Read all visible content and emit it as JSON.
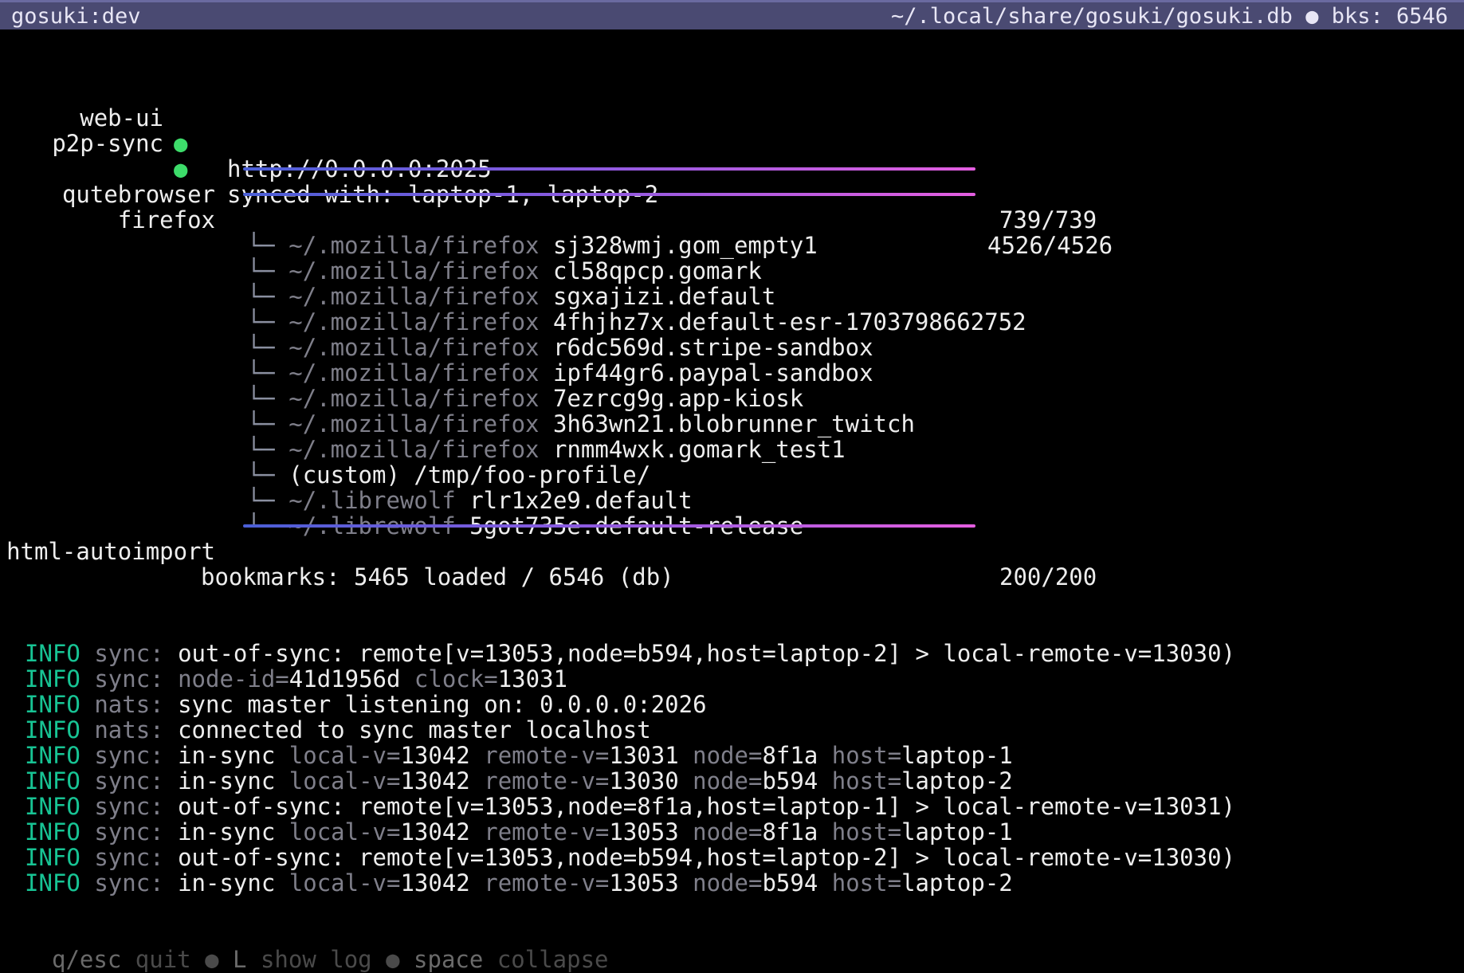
{
  "title_bar": {
    "left": "gosuki:dev",
    "right": "~/.local/share/gosuki/gosuki.db ● bks: 6546"
  },
  "services": [
    {
      "name": "web-ui",
      "status_glyph": "●",
      "status_color": "#3ddc6a",
      "detail": "http://0.0.0.0:2025"
    },
    {
      "name": "p2p-sync",
      "status_glyph": "●",
      "status_color": "#3ddc6a",
      "detail": "synced with: laptop-1, laptop-2"
    }
  ],
  "modules": [
    {
      "name": "qutebrowser",
      "count": "739/739",
      "progress": 1.0
    },
    {
      "name": "firefox",
      "count": "4526/4526",
      "progress": 1.0
    },
    {
      "name": "html-autoimport",
      "count": "200/200",
      "progress": 1.0
    }
  ],
  "firefox_profiles": [
    {
      "branch": "└─",
      "prefix": "~/.mozilla/firefox",
      "name": "sj328wmj.gom_empty1"
    },
    {
      "branch": "└─",
      "prefix": "~/.mozilla/firefox",
      "name": "cl58qpcp.gomark"
    },
    {
      "branch": "└─",
      "prefix": "~/.mozilla/firefox",
      "name": "sgxajizi.default"
    },
    {
      "branch": "└─",
      "prefix": "~/.mozilla/firefox",
      "name": "4fhjhz7x.default-esr-1703798662752"
    },
    {
      "branch": "└─",
      "prefix": "~/.mozilla/firefox",
      "name": "r6dc569d.stripe-sandbox"
    },
    {
      "branch": "└─",
      "prefix": "~/.mozilla/firefox",
      "name": "ipf44gr6.paypal-sandbox"
    },
    {
      "branch": "└─",
      "prefix": "~/.mozilla/firefox",
      "name": "7ezrcg9g.app-kiosk"
    },
    {
      "branch": "└─",
      "prefix": "~/.mozilla/firefox",
      "name": "3h63wn21.blobrunner_twitch"
    },
    {
      "branch": "└─",
      "prefix": "~/.mozilla/firefox",
      "name": "rnmm4wxk.gomark_test1"
    },
    {
      "branch": "└─",
      "prefix": "",
      "name": "(custom) /tmp/foo-profile/"
    },
    {
      "branch": "└─",
      "prefix": "~/.librewolf",
      "name": "rlr1x2e9.default"
    },
    {
      "branch": "└─",
      "prefix": "~/.librewolf",
      "name": "5got735e.default-release"
    }
  ],
  "summary": "bookmarks: 5465 loaded / 6546 (db)",
  "log": [
    {
      "level": "INFO",
      "tag": "sync:",
      "parts": [
        [
          "v",
          "out-of-sync: remote[v=13053,node=b594,host=laptop-2] > local-remote-v=13030)"
        ]
      ]
    },
    {
      "level": "INFO",
      "tag": "sync:",
      "parts": [
        [
          "k",
          "node-id="
        ],
        [
          "v",
          "41d1956d "
        ],
        [
          "k",
          "clock="
        ],
        [
          "v",
          "13031"
        ]
      ]
    },
    {
      "level": "INFO",
      "tag": "nats:",
      "parts": [
        [
          "v",
          "sync master listening on: 0.0.0.0:2026"
        ]
      ]
    },
    {
      "level": "INFO",
      "tag": "nats:",
      "parts": [
        [
          "v",
          "connected to sync master localhost"
        ]
      ]
    },
    {
      "level": "INFO",
      "tag": "sync:",
      "parts": [
        [
          "v",
          "in-sync "
        ],
        [
          "k",
          "local-v="
        ],
        [
          "v",
          "13042 "
        ],
        [
          "k",
          "remote-v="
        ],
        [
          "v",
          "13031 "
        ],
        [
          "k",
          "node="
        ],
        [
          "v",
          "8f1a "
        ],
        [
          "k",
          "host="
        ],
        [
          "v",
          "laptop-1"
        ]
      ]
    },
    {
      "level": "INFO",
      "tag": "sync:",
      "parts": [
        [
          "v",
          "in-sync "
        ],
        [
          "k",
          "local-v="
        ],
        [
          "v",
          "13042 "
        ],
        [
          "k",
          "remote-v="
        ],
        [
          "v",
          "13030 "
        ],
        [
          "k",
          "node="
        ],
        [
          "v",
          "b594 "
        ],
        [
          "k",
          "host="
        ],
        [
          "v",
          "laptop-2"
        ]
      ]
    },
    {
      "level": "INFO",
      "tag": "sync:",
      "parts": [
        [
          "v",
          "out-of-sync: remote[v=13053,node=8f1a,host=laptop-1] > local-remote-v=13031)"
        ]
      ]
    },
    {
      "level": "INFO",
      "tag": "sync:",
      "parts": [
        [
          "v",
          "in-sync "
        ],
        [
          "k",
          "local-v="
        ],
        [
          "v",
          "13042 "
        ],
        [
          "k",
          "remote-v="
        ],
        [
          "v",
          "13053 "
        ],
        [
          "k",
          "node="
        ],
        [
          "v",
          "8f1a "
        ],
        [
          "k",
          "host="
        ],
        [
          "v",
          "laptop-1"
        ]
      ]
    },
    {
      "level": "INFO",
      "tag": "sync:",
      "parts": [
        [
          "v",
          "out-of-sync: remote[v=13053,node=b594,host=laptop-2] > local-remote-v=13030)"
        ]
      ]
    },
    {
      "level": "INFO",
      "tag": "sync:",
      "parts": [
        [
          "v",
          "in-sync "
        ],
        [
          "k",
          "local-v="
        ],
        [
          "v",
          "13042 "
        ],
        [
          "k",
          "remote-v="
        ],
        [
          "v",
          "13053 "
        ],
        [
          "k",
          "node="
        ],
        [
          "v",
          "b594 "
        ],
        [
          "k",
          "host="
        ],
        [
          "v",
          "laptop-2"
        ]
      ]
    }
  ],
  "footer": [
    {
      "key": "q/esc",
      "action": "quit"
    },
    {
      "key": "L",
      "action": "show log"
    },
    {
      "key": "space",
      "action": "collapse"
    }
  ],
  "footer_sep": "●",
  "colors": {
    "title_bar_bg": "#4a4a72",
    "status_ok": "#3ddc6a",
    "info_level": "#17c494",
    "progress_start": "#4a5fd6",
    "progress_end": "#e45ee0"
  }
}
